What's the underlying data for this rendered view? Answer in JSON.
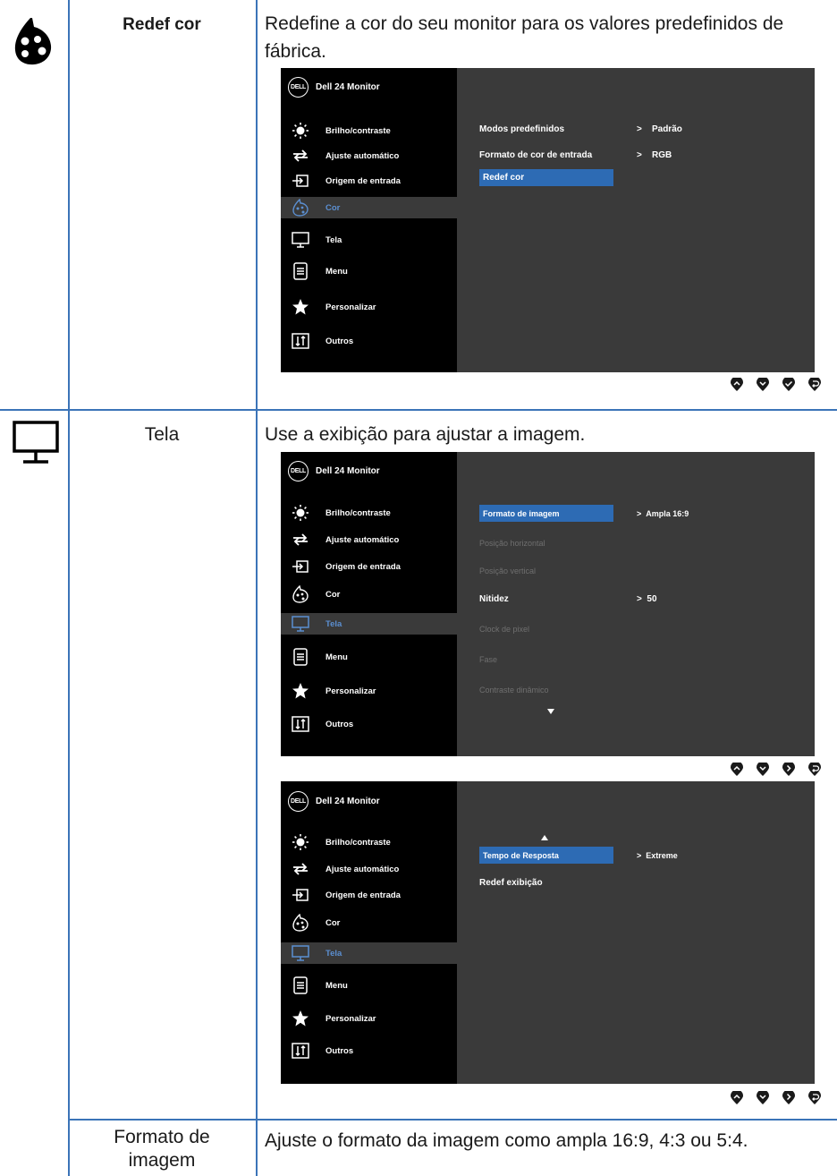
{
  "rows": [
    {
      "name": "Redef cor",
      "description": "Redefine a cor do seu monitor para os valores predefinidos de fábrica.",
      "osd": {
        "brand": "DELL",
        "title": "Dell 24 Monitor",
        "menu": [
          "Brilho/contraste",
          "Ajuste automático",
          "Origem de entrada",
          "Cor",
          "Tela",
          "Menu",
          "Personalizar",
          "Outros"
        ],
        "active": "Cor",
        "options": [
          {
            "label": "Modos predefinidos",
            "value": "Padrão"
          },
          {
            "label": "Formato de cor de entrada",
            "value": "RGB"
          },
          {
            "label": "Redef cor",
            "selected": true
          }
        ]
      }
    },
    {
      "name": "Tela",
      "description": "Use a exibição para ajustar a imagem.",
      "osd1": {
        "brand": "DELL",
        "title": "Dell 24 Monitor",
        "menu": [
          "Brilho/contraste",
          "Ajuste automático",
          "Origem de entrada",
          "Cor",
          "Tela",
          "Menu",
          "Personalizar",
          "Outros"
        ],
        "active": "Tela",
        "options": [
          {
            "label": "Formato de imagem",
            "value": "Ampla 16:9",
            "selected": true
          },
          {
            "label": "Posição horizontal",
            "dim": true
          },
          {
            "label": "Posição vertical",
            "dim": true
          },
          {
            "label": "Nitidez",
            "value": "50"
          },
          {
            "label": "Clock de pixel",
            "dim": true
          },
          {
            "label": "Fase",
            "dim": true
          },
          {
            "label": "Contraste dinâmico",
            "dim": true
          }
        ]
      },
      "osd2": {
        "brand": "DELL",
        "title": "Dell 24 Monitor",
        "menu": [
          "Brilho/contraste",
          "Ajuste automático",
          "Origem de entrada",
          "Cor",
          "Tela",
          "Menu",
          "Personalizar",
          "Outros"
        ],
        "active": "Tela",
        "options": [
          {
            "label": "Tempo de Resposta",
            "value": "Extreme",
            "selected": true
          },
          {
            "label": "Redef exibição"
          }
        ]
      }
    },
    {
      "name": "Formato de imagem",
      "description": "Ajuste o formato da imagem como ampla 16:9, 4:3 ou 5:4."
    }
  ],
  "value_prefix": ">",
  "colors": {
    "grid": "#3b74b8",
    "osd_bg": "#3a3a3a",
    "osd_menu": "#000000",
    "highlight": "#2d6bb4",
    "active_text": "#5b8fd1"
  }
}
